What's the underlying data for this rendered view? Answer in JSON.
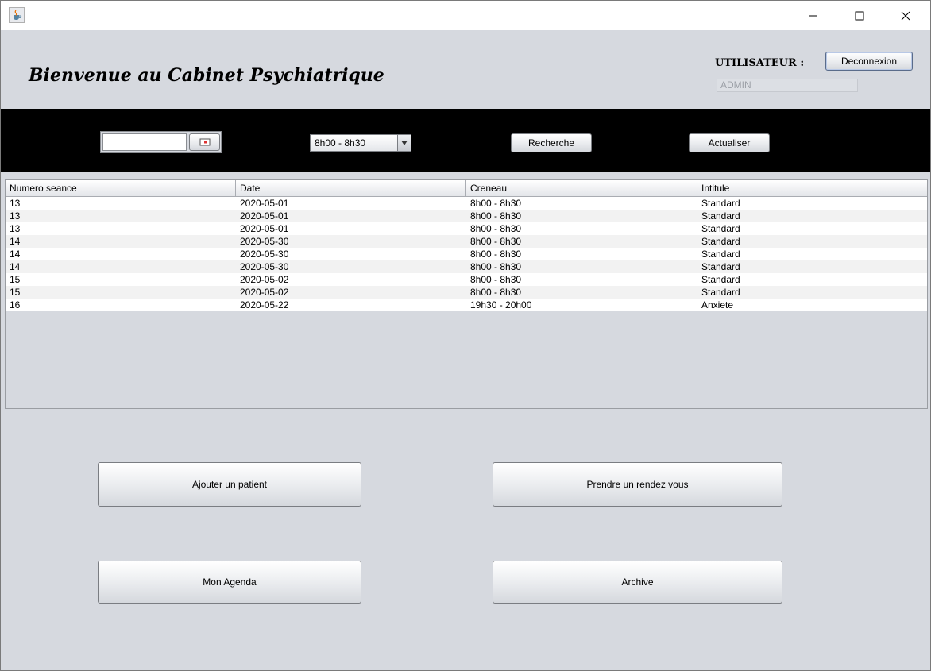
{
  "header": {
    "welcome_title": "Bienvenue au Cabinet Psychiatrique",
    "user_label": "UTILISATEUR :",
    "user_value": "ADMIN",
    "logout_label": "Deconnexion"
  },
  "toolbar": {
    "date_value": "",
    "time_slot_selected": "8h00 - 8h30",
    "search_label": "Recherche",
    "refresh_label": "Actualiser"
  },
  "table": {
    "columns": [
      "Numero seance",
      "Date",
      "Creneau",
      "Intitule"
    ],
    "rows": [
      [
        "13",
        "2020-05-01",
        "8h00 - 8h30",
        "Standard"
      ],
      [
        "13",
        "2020-05-01",
        "8h00 - 8h30",
        "Standard"
      ],
      [
        "13",
        "2020-05-01",
        "8h00 - 8h30",
        "Standard"
      ],
      [
        "14",
        "2020-05-30",
        "8h00 - 8h30",
        "Standard"
      ],
      [
        "14",
        "2020-05-30",
        "8h00 - 8h30",
        "Standard"
      ],
      [
        "14",
        "2020-05-30",
        "8h00 - 8h30",
        "Standard"
      ],
      [
        "15",
        "2020-05-02",
        "8h00 - 8h30",
        "Standard"
      ],
      [
        "15",
        "2020-05-02",
        "8h00 - 8h30",
        "Standard"
      ],
      [
        "16",
        "2020-05-22",
        "19h30 - 20h00",
        "Anxiete"
      ]
    ]
  },
  "actions": {
    "add_patient": "Ajouter un patient",
    "appointment": "Prendre un rendez vous",
    "agenda": "Mon Agenda",
    "archive": "Archive"
  },
  "icons": {
    "app": "java-cup-icon",
    "calendar": "calendar-icon",
    "dropdown": "triangle-down-icon",
    "minimize": "minimize-icon",
    "maximize": "maximize-icon",
    "close": "close-icon"
  },
  "colors": {
    "background": "#d6d9df",
    "toolbar": "#000000",
    "table_row_alt": "#f2f2f2"
  }
}
